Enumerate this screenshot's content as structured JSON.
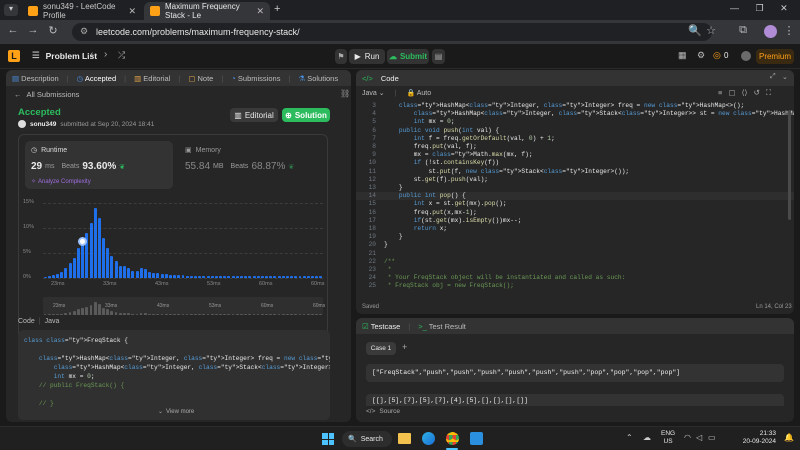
{
  "browser": {
    "tabs": [
      {
        "title": "sonu349 - LeetCode Profile",
        "active": false
      },
      {
        "title": "Maximum Frequency Stack - Le",
        "active": true
      }
    ],
    "url": "leetcode.com/problems/maximum-frequency-stack/"
  },
  "nav": {
    "problem_list": "Problem List",
    "run": "Run",
    "submit": "Submit",
    "coins": "0",
    "premium": "Premium"
  },
  "left": {
    "tabs": [
      "Description",
      "Accepted",
      "Editorial",
      "Note",
      "Submissions",
      "Solutions"
    ],
    "back": "All Submissions",
    "status": "Accepted",
    "user": "sonu349",
    "submitted": "submitted at Sep 20, 2024 18:41",
    "editorial_btn": "Editorial",
    "solution_btn": "Solution",
    "runtime": {
      "label": "Runtime",
      "value": "29",
      "unit": "ms",
      "beats_label": "Beats",
      "beats": "93.60%",
      "analyze": "Analyze Complexity"
    },
    "memory": {
      "label": "Memory",
      "value": "55.84",
      "unit": "MB",
      "beats_label": "Beats",
      "beats": "68.87%"
    },
    "code_label": "Code",
    "lang": "Java",
    "code_preview": [
      "class FreqStack {",
      "",
      "    HashMap<Integer, Integer> freq = new HashMap<>();",
      "        HashMap<Integer, Stack<Integer>> st = new HashMap<>();",
      "        int mx = 0;",
      "    // public FreqStack() {",
      "",
      "    // }"
    ],
    "view_more": "View more"
  },
  "chart_data": {
    "type": "bar",
    "y_ticks": [
      "15%",
      "10%",
      "5%",
      "0%"
    ],
    "ylim": [
      0,
      15
    ],
    "x_ticks": [
      "23ms",
      "33ms",
      "43ms",
      "53ms",
      "60ms",
      "60ms"
    ],
    "mini_x_ticks": [
      "23ms",
      "33ms",
      "43ms",
      "53ms",
      "60ms",
      "60ms"
    ],
    "values": [
      0.3,
      0.4,
      0.6,
      0.8,
      1.2,
      2,
      3,
      4,
      6,
      7.5,
      9,
      11,
      14,
      12,
      8,
      6,
      4.5,
      3.5,
      2.5,
      2.5,
      2,
      1.5,
      1.5,
      2,
      1.8,
      1.2,
      1,
      1,
      0.8,
      0.8,
      0.7,
      0.6,
      0.6,
      0.6,
      0.5,
      0.5,
      0.5,
      0.5,
      0.5,
      0.5,
      0.5,
      0.5,
      0.5,
      0.5,
      0.5,
      0.5,
      0.5,
      0.5,
      0.5,
      0.5,
      0.5,
      0.5,
      0.5,
      0.5,
      0.5,
      0.5,
      0.5,
      0.5,
      0.5,
      0.5,
      0.5,
      0.5,
      0.5,
      0.5,
      0.5,
      0.5,
      0.5
    ],
    "highlight_index": 9,
    "color": "#1f6feb"
  },
  "editor": {
    "title": "Code",
    "lang": "Java",
    "auto": "Auto",
    "lines": [
      {
        "n": "3",
        "t": "    HashMap<Integer, Integer> freq = new HashMap<>();"
      },
      {
        "n": "4",
        "t": "        HashMap<Integer, Stack<Integer>> st = new HashMap<>();"
      },
      {
        "n": "5",
        "t": "        int mx = 0;"
      },
      {
        "n": "6",
        "t": "    public void push(int val) {"
      },
      {
        "n": "7",
        "t": "        int f = freq.getOrDefault(val, 0) + 1;"
      },
      {
        "n": "8",
        "t": "        freq.put(val, f);"
      },
      {
        "n": "9",
        "t": "        mx = Math.max(mx, f);"
      },
      {
        "n": "10",
        "t": "        if (!st.containsKey(f))"
      },
      {
        "n": "11",
        "t": "            st.put(f, new Stack<Integer>());"
      },
      {
        "n": "12",
        "t": "        st.get(f).push(val);"
      },
      {
        "n": "13",
        "t": "    }"
      },
      {
        "n": "14",
        "t": "    public int pop() {"
      },
      {
        "n": "15",
        "t": "        int x = st.get(mx).pop();"
      },
      {
        "n": "16",
        "t": "        freq.put(x,mx-1);"
      },
      {
        "n": "17",
        "t": "        if(st.get(mx).isEmpty())mx--;"
      },
      {
        "n": "18",
        "t": "        return x;"
      },
      {
        "n": "19",
        "t": "    }"
      },
      {
        "n": "20",
        "t": "}"
      },
      {
        "n": "21",
        "t": ""
      },
      {
        "n": "22",
        "t": "/**"
      },
      {
        "n": "23",
        "t": " *"
      },
      {
        "n": "24",
        "t": " * Your FreqStack object will be instantiated and called as such:"
      },
      {
        "n": "25",
        "t": " * FreqStack obj = new FreqStack();"
      }
    ],
    "saved": "Saved",
    "cursor": "Ln 14, Col 23"
  },
  "testcase": {
    "tab1": "Testcase",
    "tab2": "Test Result",
    "case": "Case 1",
    "input1": "[\"FreqStack\",\"push\",\"push\",\"push\",\"push\",\"push\",\"push\",\"pop\",\"pop\",\"pop\",\"pop\"]",
    "input2": "[[],[5],[7],[5],[7],[4],[5],[],[],[],[]]",
    "source": "Source"
  },
  "taskbar": {
    "search": "Search",
    "lang": "ENG",
    "region": "US",
    "time": "21:33",
    "date": "20-09-2024"
  }
}
